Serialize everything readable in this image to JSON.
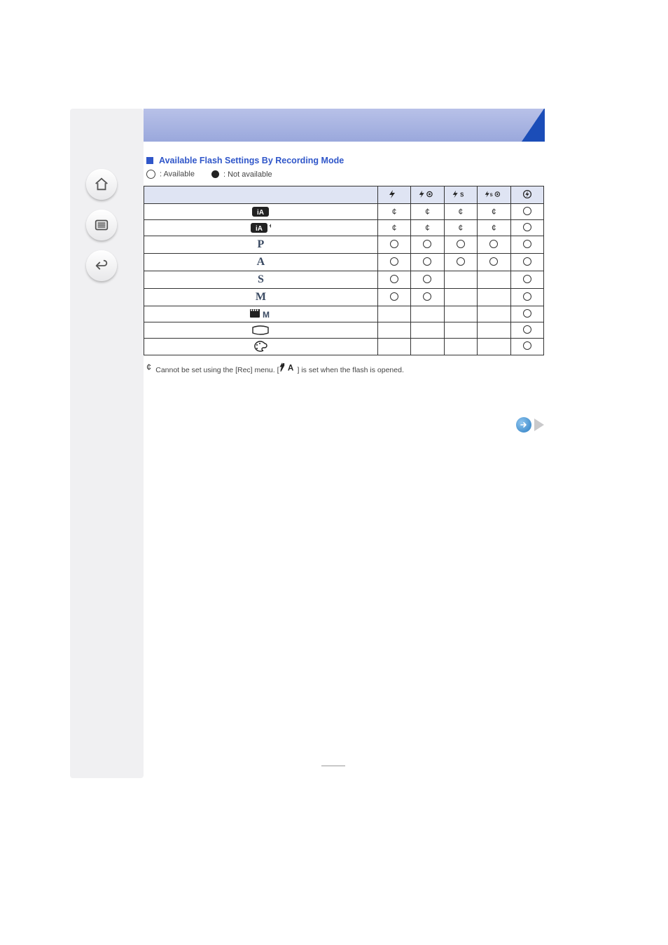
{
  "title_bar": "",
  "section": {
    "title": "Available Flash Settings By Recording Mode"
  },
  "legend": {
    "available": ": Available",
    "not_available": ": Not available"
  },
  "columns": [
    {
      "key": "forced",
      "aria": "Forced flash on"
    },
    {
      "key": "auto_redeye",
      "aria": "Auto with red-eye"
    },
    {
      "key": "slow",
      "aria": "Slow sync"
    },
    {
      "key": "slow_redeye",
      "aria": "Slow sync with red-eye"
    },
    {
      "key": "off",
      "aria": "Forced flash off"
    }
  ],
  "modes": [
    {
      "label": "iA",
      "icon": "iA",
      "cells": [
        "*",
        "*",
        "*",
        "*",
        "O"
      ]
    },
    {
      "label": "iA+",
      "icon": "iAplus",
      "cells": [
        "*",
        "*",
        "*",
        "*",
        "O"
      ]
    },
    {
      "label": "P",
      "icon": "P",
      "cells": [
        "O",
        "O",
        "O",
        "O",
        "O"
      ]
    },
    {
      "label": "A",
      "icon": "A",
      "cells": [
        "O",
        "O",
        "O",
        "O",
        "O"
      ]
    },
    {
      "label": "S",
      "icon": "S",
      "cells": [
        "O",
        "O",
        "",
        "",
        "O"
      ]
    },
    {
      "label": "M",
      "icon": "M",
      "cells": [
        "O",
        "O",
        "",
        "",
        "O"
      ]
    },
    {
      "label": "Movie-M",
      "icon": "movieM",
      "cells": [
        "",
        "",
        "",
        "",
        "O"
      ]
    },
    {
      "label": "Panorama",
      "icon": "pano",
      "cells": [
        "",
        "",
        "",
        "",
        "O"
      ]
    },
    {
      "label": "Palette",
      "icon": "palette",
      "cells": [
        "",
        "",
        "",
        "",
        "O"
      ]
    }
  ],
  "footnote": {
    "star": "¢",
    "text_before": "Cannot be set using the [Rec] menu. [",
    "icon": "iflashA",
    "text_after": "] is set when the flash is opened."
  },
  "pager": {
    "next": "Next page"
  }
}
